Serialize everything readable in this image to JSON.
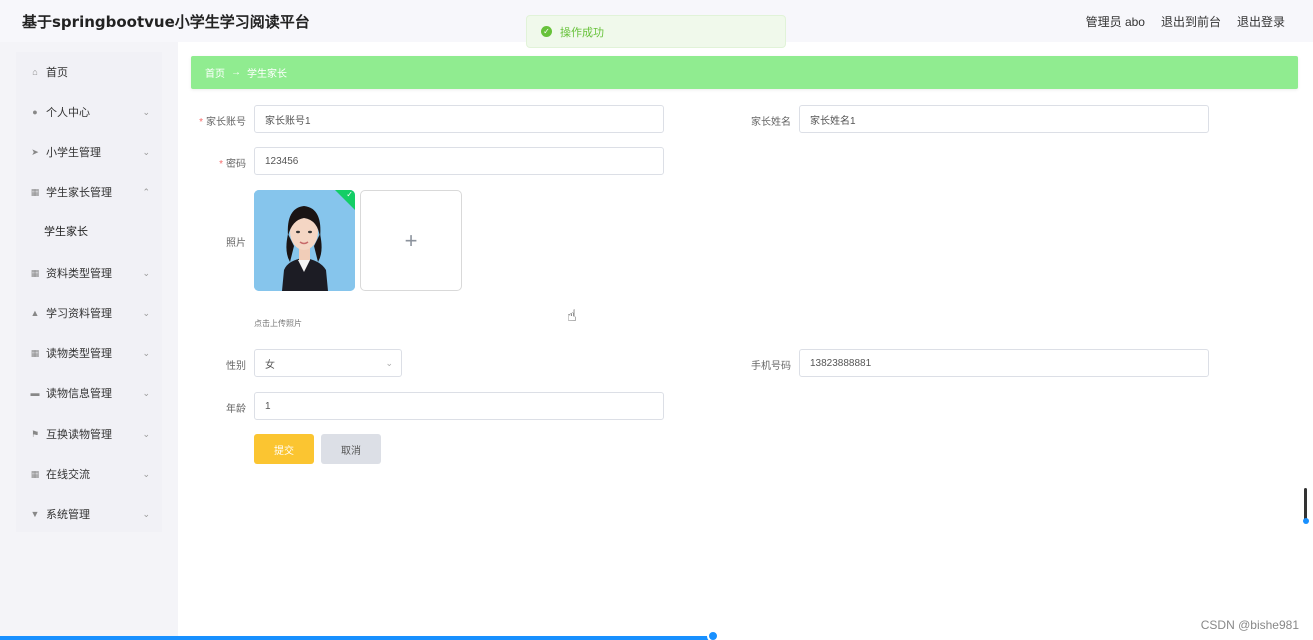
{
  "app": {
    "title": "基于springbootvue小学生学习阅读平台",
    "admin_label": "管理员 abo",
    "front_link": "退出到前台",
    "logout_link": "退出登录"
  },
  "toast": {
    "text": "操作成功"
  },
  "sidebar": {
    "items": [
      {
        "label": "首页",
        "icon": "home-icon"
      },
      {
        "label": "个人中心",
        "icon": "user-icon"
      },
      {
        "label": "小学生管理",
        "icon": "send-icon"
      },
      {
        "label": "学生家长管理",
        "icon": "grid-icon"
      },
      {
        "label": "资料类型管理",
        "icon": "grid-icon"
      },
      {
        "label": "学习资料管理",
        "icon": "thumb-icon"
      },
      {
        "label": "读物类型管理",
        "icon": "grid-icon"
      },
      {
        "label": "读物信息管理",
        "icon": "tray-icon"
      },
      {
        "label": "互换读物管理",
        "icon": "flag-icon"
      },
      {
        "label": "在线交流",
        "icon": "grid-icon"
      },
      {
        "label": "系统管理",
        "icon": "funnel-icon"
      }
    ],
    "submenu": {
      "label": "学生家长"
    }
  },
  "breadcrumb": {
    "home": "首页",
    "arrow": "→",
    "current": "学生家长"
  },
  "form": {
    "account_label": "家长账号",
    "account_value": "家长账号1",
    "name_label": "家长姓名",
    "name_value": "家长姓名1",
    "password_label": "密码",
    "password_value": "123456",
    "photo_label": "照片",
    "upload_plus": "+",
    "upload_tip": "点击上传照片",
    "gender_label": "性别",
    "gender_value": "女",
    "phone_label": "手机号码",
    "phone_value": "13823888881",
    "age_label": "年龄",
    "age_value": "1",
    "submit_label": "提交",
    "cancel_label": "取消",
    "required_mark": "*"
  },
  "watermark": "CSDN @bishe981",
  "colors": {
    "breadcrumb_bg": "#90ec90",
    "submit_bg": "#fbc531",
    "toast_text": "#67c23a",
    "success_badge": "#13ce66"
  }
}
